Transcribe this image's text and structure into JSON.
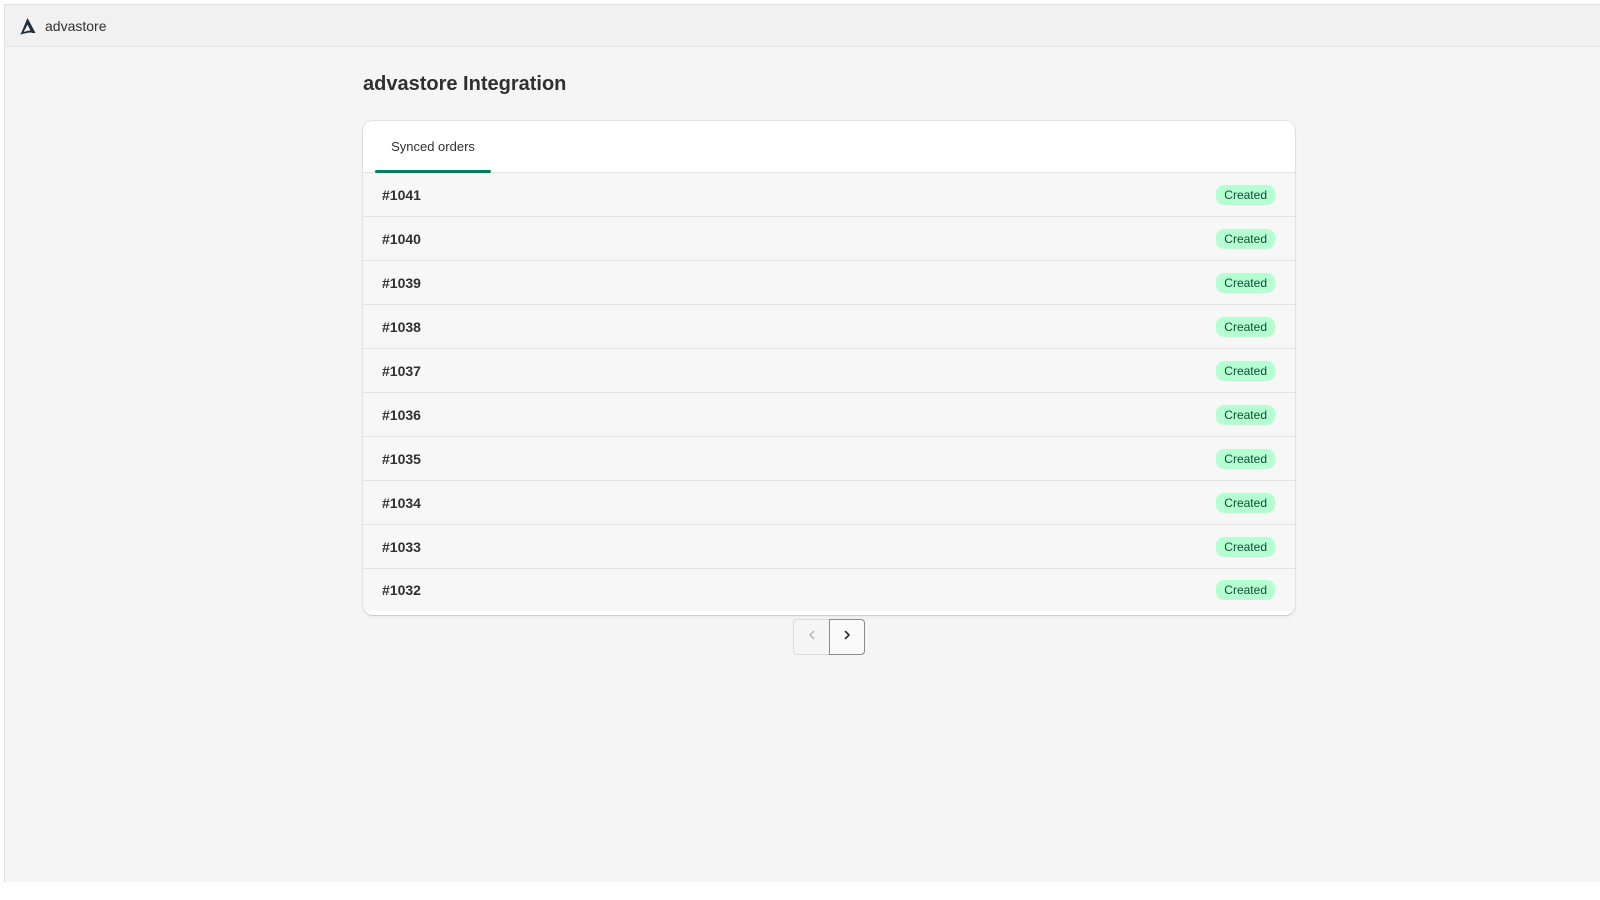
{
  "app": {
    "brand_name": "advastore",
    "logo_icon": "advastore-logo-icon"
  },
  "page": {
    "title": "advastore Integration"
  },
  "tabs": [
    {
      "label": "Synced orders",
      "selected": true
    }
  ],
  "orders": [
    {
      "id": "#1041",
      "status": "Created"
    },
    {
      "id": "#1040",
      "status": "Created"
    },
    {
      "id": "#1039",
      "status": "Created"
    },
    {
      "id": "#1038",
      "status": "Created"
    },
    {
      "id": "#1037",
      "status": "Created"
    },
    {
      "id": "#1036",
      "status": "Created"
    },
    {
      "id": "#1035",
      "status": "Created"
    },
    {
      "id": "#1034",
      "status": "Created"
    },
    {
      "id": "#1033",
      "status": "Created"
    },
    {
      "id": "#1032",
      "status": "Created"
    }
  ],
  "pagination": {
    "previous_icon": "chevron-left-icon",
    "next_icon": "chevron-right-icon",
    "previous_enabled": false,
    "next_enabled": true
  },
  "colors": {
    "accent": "#008060",
    "badge_background": "#b4fed2",
    "badge_text": "#0c5132",
    "page_background": "#f5f5f5"
  }
}
